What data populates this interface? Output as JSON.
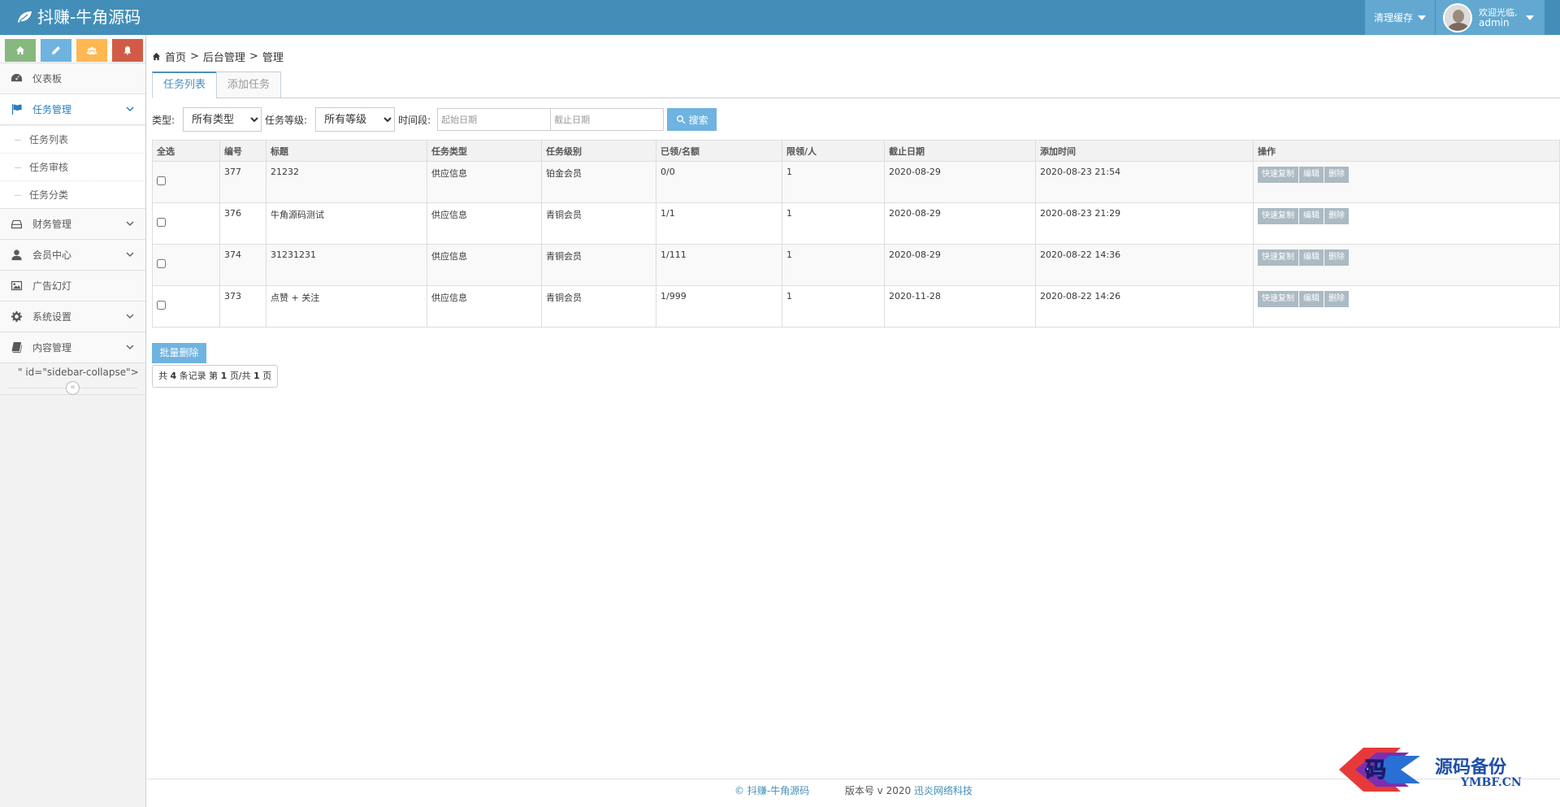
{
  "navbar": {
    "brand": "抖赚-牛角源码",
    "clear_cache": "清理缓存",
    "welcome": "欢迎光临,",
    "username": "admin"
  },
  "sidebar": {
    "items": [
      {
        "label": "仪表板",
        "icon": "dashboard-icon"
      },
      {
        "label": "任务管理",
        "icon": "flag-icon",
        "active": true
      },
      {
        "label": "财务管理",
        "icon": "hdd-icon"
      },
      {
        "label": "会员中心",
        "icon": "user-icon"
      },
      {
        "label": "广告幻灯",
        "icon": "picture-icon"
      },
      {
        "label": "系统设置",
        "icon": "gear-icon"
      },
      {
        "label": "内容管理",
        "icon": "book-icon"
      }
    ],
    "submenu": [
      "任务列表",
      "任务审核",
      "任务分类"
    ],
    "stray_text": "\" id=\"sidebar-collapse\">",
    "collapse_glyph": "«"
  },
  "breadcrumb": {
    "home": "首页",
    "level2": "后台管理",
    "level3": "管理",
    "sep": ">"
  },
  "tabs": [
    "任务列表",
    "添加任务"
  ],
  "filters": {
    "type_label": "类型:",
    "type_value": "所有类型",
    "level_label": "任务等级:",
    "level_value": "所有等级",
    "period_label": "时间段:",
    "start_placeholder": "起始日期",
    "end_placeholder": "截止日期",
    "search_label": "搜索"
  },
  "table": {
    "headers": [
      "全选",
      "编号",
      "标题",
      "任务类型",
      "任务级别",
      "已领/名额",
      "限领/人",
      "截止日期",
      "添加时间",
      "操作"
    ],
    "rows": [
      {
        "id": "377",
        "title": "21232",
        "type": "供应信息",
        "level": "铂金会员",
        "quota": "0/0",
        "limit": "1",
        "deadline": "2020-08-29",
        "added": "2020-08-23 21:54"
      },
      {
        "id": "376",
        "title": "牛角源码测试",
        "type": "供应信息",
        "level": "青铜会员",
        "quota": "1/1",
        "limit": "1",
        "deadline": "2020-08-29",
        "added": "2020-08-23 21:29"
      },
      {
        "id": "374",
        "title": "31231231",
        "type": "供应信息",
        "level": "青铜会员",
        "quota": "1/111",
        "limit": "1",
        "deadline": "2020-08-29",
        "added": "2020-08-22 14:36"
      },
      {
        "id": "373",
        "title": "点赞 + 关注",
        "type": "供应信息",
        "level": "青铜会员",
        "quota": "1/999",
        "limit": "1",
        "deadline": "2020-11-28",
        "added": "2020-08-22 14:26"
      }
    ],
    "actions": {
      "copy": "快速复制",
      "edit": "编辑",
      "delete": "删除"
    }
  },
  "batch_delete": "批量删除",
  "pager": {
    "prefix": "共",
    "total": "4",
    "mid1": "条记录 第",
    "page": "1",
    "mid2": "页/共",
    "pages": "1",
    "suffix": "页"
  },
  "footer": {
    "brand": "© 抖赚-牛角源码",
    "version": "版本号 v 2020",
    "company": "迅炎网络科技"
  },
  "watermark": {
    "glyph": "码",
    "text": "源码备份",
    "sub": "YMBF.CN"
  },
  "colors": {
    "navbar": "#438eb9",
    "accent": "#6fb3e0",
    "action_button": "#abbac3"
  }
}
